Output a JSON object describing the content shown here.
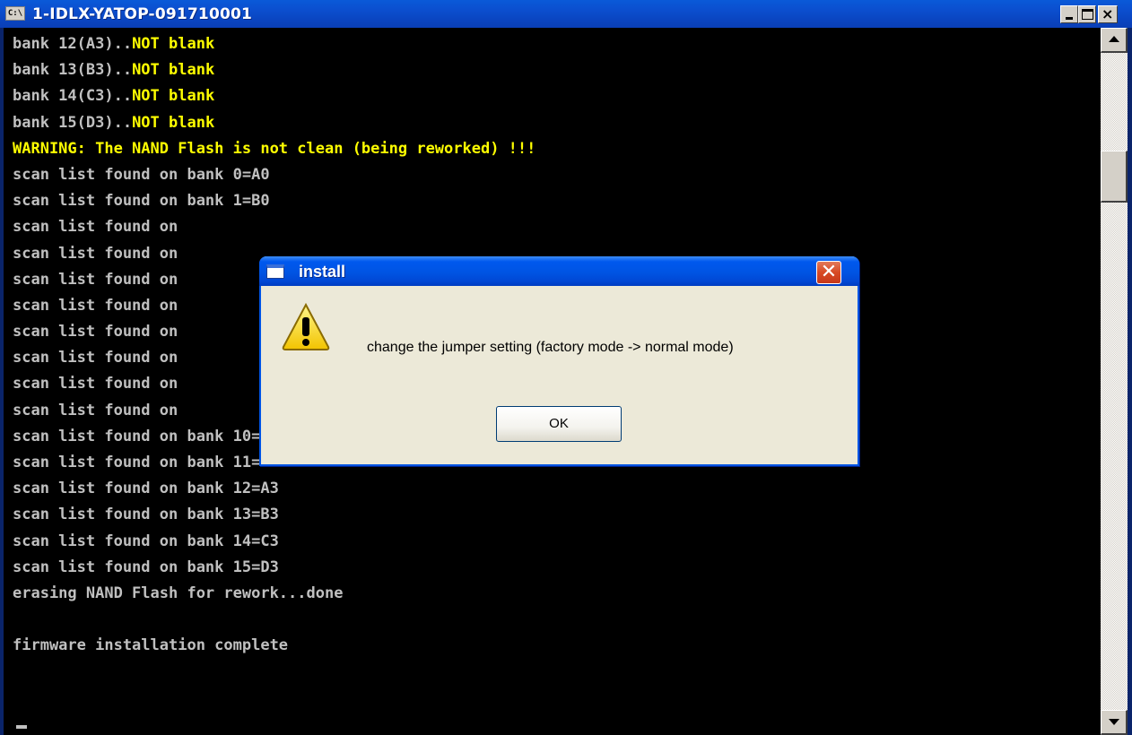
{
  "console_window": {
    "title": "1-IDLX-YATOP-091710001",
    "icon_label": "C:\\",
    "lines": [
      {
        "text": "bank 12(A3)..",
        "highlight": "NOT blank"
      },
      {
        "text": "bank 13(B3)..",
        "highlight": "NOT blank"
      },
      {
        "text": "bank 14(C3)..",
        "highlight": "NOT blank"
      },
      {
        "text": "bank 15(D3)..",
        "highlight": "NOT blank"
      },
      {
        "text": "",
        "highlight": "WARNING: The NAND Flash is not clean (being reworked) !!!"
      },
      {
        "text": "scan list found on bank 0=A0",
        "highlight": ""
      },
      {
        "text": "scan list found on bank 1=B0",
        "highlight": ""
      },
      {
        "text": "scan list found on",
        "highlight": ""
      },
      {
        "text": "scan list found on",
        "highlight": ""
      },
      {
        "text": "scan list found on",
        "highlight": ""
      },
      {
        "text": "scan list found on",
        "highlight": ""
      },
      {
        "text": "scan list found on",
        "highlight": ""
      },
      {
        "text": "scan list found on",
        "highlight": ""
      },
      {
        "text": "scan list found on",
        "highlight": ""
      },
      {
        "text": "scan list found on",
        "highlight": ""
      },
      {
        "text": "scan list found on bank 10=C2",
        "highlight": ""
      },
      {
        "text": "scan list found on bank 11=D2",
        "highlight": ""
      },
      {
        "text": "scan list found on bank 12=A3",
        "highlight": ""
      },
      {
        "text": "scan list found on bank 13=B3",
        "highlight": ""
      },
      {
        "text": "scan list found on bank 14=C3",
        "highlight": ""
      },
      {
        "text": "scan list found on bank 15=D3",
        "highlight": ""
      },
      {
        "text": "erasing NAND Flash for rework...done",
        "highlight": ""
      },
      {
        "text": "",
        "highlight": ""
      },
      {
        "text": "firmware installation complete",
        "highlight": ""
      }
    ]
  },
  "dialog": {
    "title": "install",
    "message": "change the jumper setting (factory mode -> normal mode)",
    "ok_label": "OK",
    "close_glyph": "✕"
  },
  "colors": {
    "console_text": "#c0c0c0",
    "highlight_text": "#ffff00",
    "titlebar_blue": "#0054e3"
  }
}
